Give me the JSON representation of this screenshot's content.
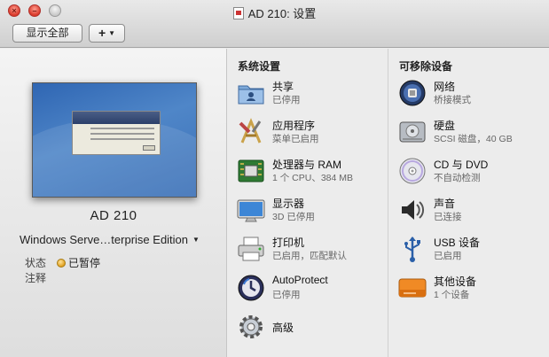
{
  "window": {
    "title": "AD 210: 设置"
  },
  "toolbar": {
    "show_all_label": "显示全部",
    "add_label": "+"
  },
  "vm": {
    "name": "AD 210",
    "os": "Windows Serve…terprise Edition",
    "state_label": "状态",
    "state_value": "已暂停",
    "note_label": "注释"
  },
  "system": {
    "heading": "系统设置",
    "items": [
      {
        "name": "共享",
        "sub": "已停用",
        "icon": "shared-folder-icon"
      },
      {
        "name": "应用程序",
        "sub": "菜单已启用",
        "icon": "applications-icon"
      },
      {
        "name": "处理器与 RAM",
        "sub": "1 个 CPU、384 MB",
        "icon": "processor-icon"
      },
      {
        "name": "显示器",
        "sub": "3D 已停用",
        "icon": "display-icon"
      },
      {
        "name": "打印机",
        "sub": "已启用，匹配默认",
        "icon": "printer-icon"
      },
      {
        "name": "AutoProtect",
        "sub": "已停用",
        "icon": "autoprotect-icon"
      },
      {
        "name": "高级",
        "sub": "",
        "icon": "advanced-gear-icon"
      }
    ]
  },
  "removable": {
    "heading": "可移除设备",
    "items": [
      {
        "name": "网络",
        "sub": "桥接模式",
        "icon": "network-icon"
      },
      {
        "name": "硬盘",
        "sub": "SCSI 磁盘，40 GB",
        "icon": "hard-disk-icon"
      },
      {
        "name": "CD 与 DVD",
        "sub": "不自动检测",
        "icon": "cd-dvd-icon"
      },
      {
        "name": "声音",
        "sub": "已连接",
        "icon": "sound-icon"
      },
      {
        "name": "USB 设备",
        "sub": "已启用",
        "icon": "usb-icon"
      },
      {
        "name": "其他设备",
        "sub": "1 个设备",
        "icon": "other-devices-icon"
      }
    ]
  }
}
